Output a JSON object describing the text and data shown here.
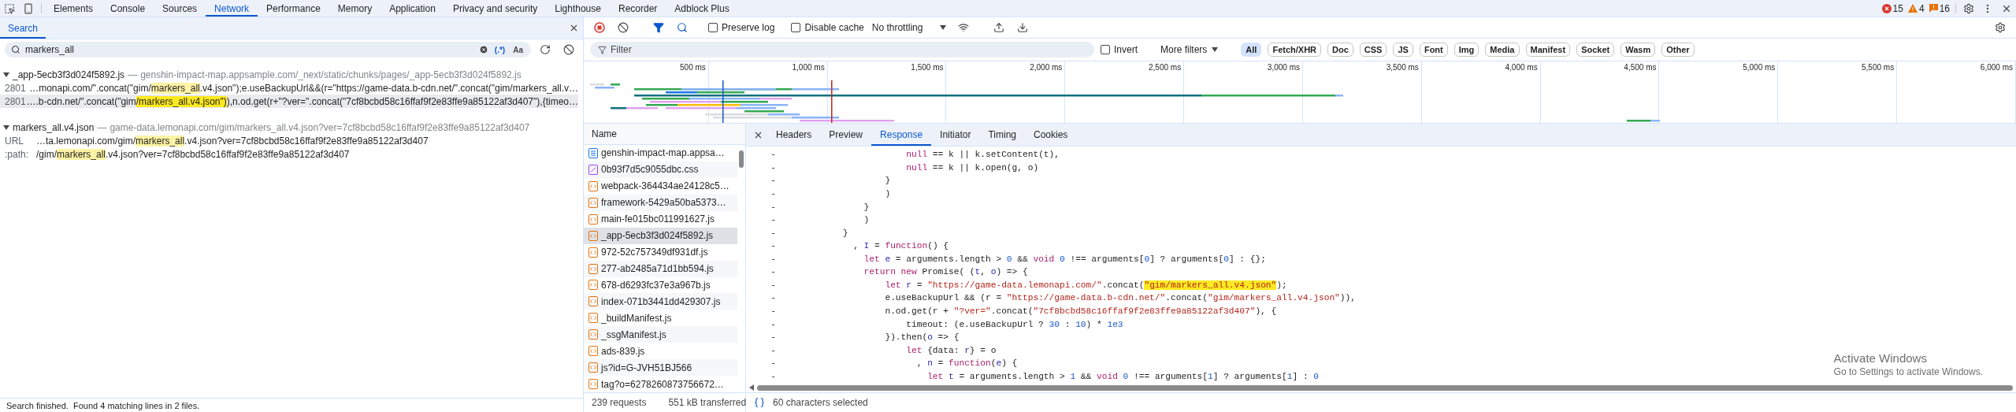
{
  "devtools_tabs": [
    {
      "label": "Elements",
      "selected": false
    },
    {
      "label": "Console",
      "selected": false
    },
    {
      "label": "Sources",
      "selected": false
    },
    {
      "label": "Network",
      "selected": true
    },
    {
      "label": "Performance",
      "selected": false
    },
    {
      "label": "Memory",
      "selected": false
    },
    {
      "label": "Application",
      "selected": false
    },
    {
      "label": "Privacy and security",
      "selected": false
    },
    {
      "label": "Lighthouse",
      "selected": false
    },
    {
      "label": "Recorder",
      "selected": false
    },
    {
      "label": "Adblock Plus",
      "selected": false
    }
  ],
  "issue_counts": {
    "errors": "15",
    "warnings": "4",
    "issues": "16"
  },
  "search_panel": {
    "tab": "Search",
    "query": "markers_all",
    "regex_toggle": "(.*)",
    "case_toggle": "Aa",
    "results": [
      {
        "file": "_app-5ecb3f3d024f5892.js",
        "separator": "—",
        "location": "genshin-impact-map.appsample.com/_next/static/chunks/pages/_app-5ecb3f3d024f5892.js",
        "expanded": true,
        "matches": [
          {
            "label": "2801",
            "selected": false,
            "segments": [
              {
                "kind": "text",
                "text": "…monapi.com/\".concat(\"gim/"
              },
              {
                "kind": "match",
                "text": "markers_all"
              },
              {
                "kind": "text",
                "text": ".v4.json\");e.useBackupUrl&&(r=\"https://game-data.b-cdn.net/\".concat(\"gim/markers_all.v…"
              }
            ]
          },
          {
            "label": "2801",
            "selected": true,
            "segments": [
              {
                "kind": "text",
                "text": "….b-cdn.net/\".concat(\"gim"
              },
              {
                "kind": "current",
                "text": "/markers_all.v4.json\")"
              },
              {
                "kind": "text",
                "text": "),n.od.get(r+\"?ver=\".concat(\"7cf8bcbd58c16ffaf9f2e83ffe9a85122af3d407\"),{timeo…"
              }
            ]
          }
        ]
      },
      {
        "file": "markers_all.v4.json",
        "separator": "—",
        "location": "game-data.lemonapi.com/gim/markers_all.v4.json?ver=7cf8bcbd58c16ffaf9f2e83ffe9a85122af3d407",
        "expanded": true,
        "matches": [
          {
            "label": "URL",
            "selected": false,
            "segments": [
              {
                "kind": "text",
                "text": "…ta.lemonapi.com/gim/"
              },
              {
                "kind": "match",
                "text": "markers_all"
              },
              {
                "kind": "text",
                "text": ".v4.json?ver=7cf8bcbd58c16ffaf9f2e83ffe9a85122af3d407"
              }
            ]
          },
          {
            "label": ":path:",
            "selected": false,
            "segments": [
              {
                "kind": "text",
                "text": "/gim/"
              },
              {
                "kind": "match",
                "text": "markers_all"
              },
              {
                "kind": "text",
                "text": ".v4.json?ver=7cf8bcbd58c16ffaf9f2e83ffe9a85122af3d407"
              }
            ]
          }
        ]
      }
    ],
    "status": "Search finished.  Found 4 matching lines in 2 files."
  },
  "network": {
    "toolbar": {
      "recording": true,
      "preserve_log": {
        "label": "Preserve log",
        "checked": false
      },
      "disable_cache": {
        "label": "Disable cache",
        "checked": false
      },
      "throttling": "No throttling"
    },
    "filter": {
      "placeholder": "Filter",
      "invert": {
        "label": "Invert",
        "checked": false
      },
      "more_filters": "More filters",
      "types": [
        {
          "label": "All",
          "selected": true
        },
        {
          "label": "Fetch/XHR",
          "selected": false
        },
        {
          "label": "Doc",
          "selected": false
        },
        {
          "label": "CSS",
          "selected": false
        },
        {
          "label": "JS",
          "selected": false
        },
        {
          "label": "Font",
          "selected": false
        },
        {
          "label": "Img",
          "selected": false
        },
        {
          "label": "Media",
          "selected": false
        },
        {
          "label": "Manifest",
          "selected": false
        },
        {
          "label": "Socket",
          "selected": false
        },
        {
          "label": "Wasm",
          "selected": false
        },
        {
          "label": "Other",
          "selected": false
        }
      ]
    },
    "timeline": {
      "ticks": [
        "500 ms",
        "1,000 ms",
        "1,500 ms",
        "2,000 ms",
        "2,500 ms",
        "3,000 ms",
        "3,500 ms",
        "4,000 ms",
        "4,500 ms",
        "5,000 ms",
        "5,500 ms",
        "6,000 ms"
      ]
    },
    "requests": {
      "header": "Name",
      "items": [
        {
          "name": "genshin-impact-map.appsa…",
          "kind": "document",
          "selected": false
        },
        {
          "name": "0b93f7d5c9055dbc.css",
          "kind": "stylesheet",
          "selected": false
        },
        {
          "name": "webpack-364434ae24128c5…",
          "kind": "script",
          "selected": false
        },
        {
          "name": "framework-5429a50ba5373…",
          "kind": "script",
          "selected": false
        },
        {
          "name": "main-fe015bc011991627.js",
          "kind": "script",
          "selected": false
        },
        {
          "name": "_app-5ecb3f3d024f5892.js",
          "kind": "script",
          "selected": true
        },
        {
          "name": "972-52c757349df931df.js",
          "kind": "script",
          "selected": false
        },
        {
          "name": "277-ab2485a71d1bb594.js",
          "kind": "script",
          "selected": false
        },
        {
          "name": "678-d6293fc37e3a967b.js",
          "kind": "script",
          "selected": false
        },
        {
          "name": "index-071b3441dd429307.js",
          "kind": "script",
          "selected": false
        },
        {
          "name": "_buildManifest.js",
          "kind": "script",
          "selected": false
        },
        {
          "name": "_ssgManifest.js",
          "kind": "script",
          "selected": false
        },
        {
          "name": "ads-839.js",
          "kind": "script",
          "selected": false
        },
        {
          "name": "js?id=G-JVH51BJ566",
          "kind": "script",
          "selected": false
        },
        {
          "name": "tag?o=6278260873756672…",
          "kind": "script",
          "selected": false
        }
      ]
    },
    "details": {
      "tabs": [
        {
          "label": "Headers",
          "selected": false
        },
        {
          "label": "Preview",
          "selected": false
        },
        {
          "label": "Response",
          "selected": true
        },
        {
          "label": "Initiator",
          "selected": false
        },
        {
          "label": "Timing",
          "selected": false
        },
        {
          "label": "Cookies",
          "selected": false
        }
      ],
      "code_lines": [
        {
          "gutter": "-",
          "tokens": [
            {
              "kind": "keyword",
              "text": "                    null"
            },
            {
              "kind": "plain",
              "text": " == k || k.setContent(t),"
            }
          ]
        },
        {
          "gutter": "-",
          "tokens": [
            {
              "kind": "keyword",
              "text": "                    null"
            },
            {
              "kind": "plain",
              "text": " == k || k.open(g, o)"
            }
          ]
        },
        {
          "gutter": "-",
          "tokens": [
            {
              "kind": "plain",
              "text": "                }"
            }
          ]
        },
        {
          "gutter": "-",
          "tokens": [
            {
              "kind": "plain",
              "text": "                )"
            }
          ]
        },
        {
          "gutter": "-",
          "tokens": [
            {
              "kind": "plain",
              "text": "            }"
            }
          ]
        },
        {
          "gutter": "-",
          "tokens": [
            {
              "kind": "plain",
              "text": "            )"
            }
          ]
        },
        {
          "gutter": "-",
          "tokens": [
            {
              "kind": "plain",
              "text": "        }"
            }
          ]
        },
        {
          "gutter": "-",
          "tokens": [
            {
              "kind": "plain",
              "text": "          , "
            },
            {
              "kind": "def",
              "text": "I"
            },
            {
              "kind": "plain",
              "text": " = "
            },
            {
              "kind": "keyword",
              "text": "function"
            },
            {
              "kind": "plain",
              "text": "() {"
            }
          ]
        },
        {
          "gutter": "-",
          "tokens": [
            {
              "kind": "keyword",
              "text": "            let"
            },
            {
              "kind": "def",
              "text": " e"
            },
            {
              "kind": "plain",
              "text": " = arguments.length > "
            },
            {
              "kind": "number",
              "text": "0"
            },
            {
              "kind": "plain",
              "text": " && "
            },
            {
              "kind": "keyword",
              "text": "void"
            },
            {
              "kind": "number",
              "text": " 0"
            },
            {
              "kind": "plain",
              "text": " !== arguments["
            },
            {
              "kind": "number",
              "text": "0"
            },
            {
              "kind": "plain",
              "text": "] ? arguments["
            },
            {
              "kind": "number",
              "text": "0"
            },
            {
              "kind": "plain",
              "text": "] : {};"
            }
          ]
        },
        {
          "gutter": "-",
          "tokens": [
            {
              "kind": "keyword",
              "text": "            return new"
            },
            {
              "kind": "plain",
              "text": " Promise( ("
            },
            {
              "kind": "def",
              "text": "t"
            },
            {
              "kind": "plain",
              "text": ", "
            },
            {
              "kind": "def",
              "text": "o"
            },
            {
              "kind": "plain",
              "text": ") => {"
            }
          ]
        },
        {
          "gutter": "-",
          "tokens": [
            {
              "kind": "keyword",
              "text": "                let"
            },
            {
              "kind": "def",
              "text": " r"
            },
            {
              "kind": "plain",
              "text": " = "
            },
            {
              "kind": "string",
              "text": "\"https://game-data.lemonapi.com/\""
            },
            {
              "kind": "plain",
              "text": ".concat("
            },
            {
              "kind": "match",
              "text": "\"gim/markers_all.v4.json\""
            },
            {
              "kind": "plain",
              "text": ");"
            }
          ]
        },
        {
          "gutter": "-",
          "tokens": [
            {
              "kind": "plain",
              "text": "                e.useBackupUrl && (r = "
            },
            {
              "kind": "string",
              "text": "\"https://game-data.b-cdn.net/\""
            },
            {
              "kind": "plain",
              "text": ".concat("
            },
            {
              "kind": "string",
              "text": "\"gim/markers_all.v4.json\""
            },
            {
              "kind": "plain",
              "text": ")),"
            }
          ]
        },
        {
          "gutter": "-",
          "tokens": [
            {
              "kind": "plain",
              "text": "                n.od.get(r + "
            },
            {
              "kind": "string",
              "text": "\"?ver=\""
            },
            {
              "kind": "plain",
              "text": ".concat("
            },
            {
              "kind": "string",
              "text": "\"7cf8bcbd58c16ffaf9f2e83ffe9a85122af3d407\""
            },
            {
              "kind": "plain",
              "text": "), {"
            }
          ]
        },
        {
          "gutter": "-",
          "tokens": [
            {
              "kind": "plain",
              "text": "                    timeout: (e.useBackupUrl ? "
            },
            {
              "kind": "number",
              "text": "30"
            },
            {
              "kind": "plain",
              "text": " : "
            },
            {
              "kind": "number",
              "text": "10"
            },
            {
              "kind": "plain",
              "text": ") * "
            },
            {
              "kind": "number",
              "text": "1e3"
            }
          ]
        },
        {
          "gutter": "-",
          "tokens": [
            {
              "kind": "plain",
              "text": "                }).then("
            },
            {
              "kind": "def",
              "text": "o"
            },
            {
              "kind": "plain",
              "text": " => {"
            }
          ]
        },
        {
          "gutter": "-",
          "tokens": [
            {
              "kind": "keyword",
              "text": "                    let"
            },
            {
              "kind": "plain",
              "text": " {data: "
            },
            {
              "kind": "def",
              "text": "r"
            },
            {
              "kind": "plain",
              "text": "} = o"
            }
          ]
        },
        {
          "gutter": "-",
          "tokens": [
            {
              "kind": "plain",
              "text": "                      , "
            },
            {
              "kind": "def",
              "text": "n"
            },
            {
              "kind": "plain",
              "text": " = "
            },
            {
              "kind": "keyword",
              "text": "function"
            },
            {
              "kind": "plain",
              "text": "("
            },
            {
              "kind": "def",
              "text": "e"
            },
            {
              "kind": "plain",
              "text": ") {"
            }
          ]
        },
        {
          "gutter": "-",
          "tokens": [
            {
              "kind": "keyword",
              "text": "                        let"
            },
            {
              "kind": "def",
              "text": " t"
            },
            {
              "kind": "plain",
              "text": " = arguments.length > "
            },
            {
              "kind": "number",
              "text": "1"
            },
            {
              "kind": "plain",
              "text": " && "
            },
            {
              "kind": "keyword",
              "text": "void"
            },
            {
              "kind": "number",
              "text": " 0"
            },
            {
              "kind": "plain",
              "text": " !== arguments["
            },
            {
              "kind": "number",
              "text": "1"
            },
            {
              "kind": "plain",
              "text": "] ? arguments["
            },
            {
              "kind": "number",
              "text": "1"
            },
            {
              "kind": "plain",
              "text": "] : "
            },
            {
              "kind": "number",
              "text": "0"
            }
          ]
        }
      ]
    },
    "status": {
      "requests": "239 requests",
      "transferred": "551 kB transferred",
      "selection": "60 characters selected"
    }
  },
  "os_overlay": {
    "title": "Activate Windows",
    "subtitle": "Go to Settings to activate Windows."
  }
}
